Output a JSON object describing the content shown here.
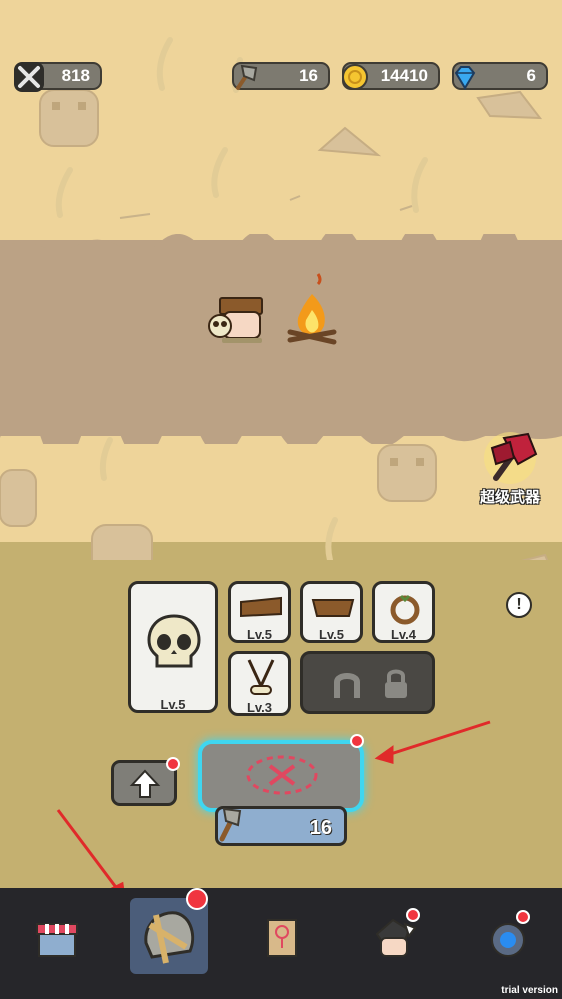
{
  "resources": {
    "power": "818",
    "stone_axe": "16",
    "gold": "14410",
    "gems": "6"
  },
  "special_weapon": {
    "label": "超级武器"
  },
  "equipment": {
    "main": {
      "level": "Lv.5",
      "icon": "skull-icon"
    },
    "slots": [
      {
        "level": "Lv.5",
        "icon": "wood-plank-icon"
      },
      {
        "level": "Lv.5",
        "icon": "wood-bowl-icon"
      },
      {
        "level": "Lv.4",
        "icon": "ring-icon"
      },
      {
        "level": "Lv.3",
        "icon": "bone-necklace-icon"
      }
    ],
    "locked_slot": {
      "icon": "horseshoe-icon"
    }
  },
  "forge": {
    "cost": "16"
  },
  "nav": [
    {
      "name": "shop",
      "icon": "shop-icon"
    },
    {
      "name": "forge",
      "icon": "helmet-icon"
    },
    {
      "name": "map",
      "icon": "map-icon"
    },
    {
      "name": "heroes",
      "icon": "hero-icon"
    },
    {
      "name": "portal",
      "icon": "portal-icon"
    }
  ],
  "watermark": "trial version",
  "colors": {
    "notification": "#f0353f",
    "forge_glow": "#3fd6f0"
  }
}
